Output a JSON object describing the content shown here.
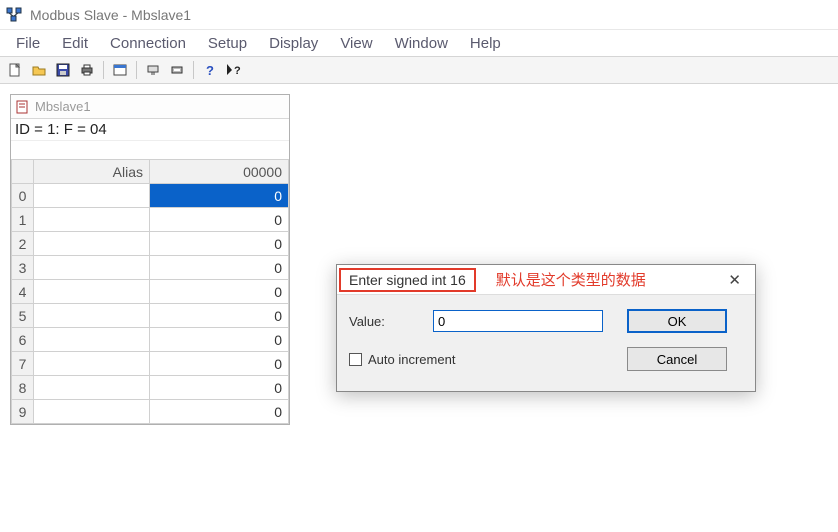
{
  "app": {
    "title": "Modbus Slave - Mbslave1"
  },
  "menu": {
    "items": [
      "File",
      "Edit",
      "Connection",
      "Setup",
      "Display",
      "View",
      "Window",
      "Help"
    ]
  },
  "toolbar": {
    "icons": [
      "new",
      "open",
      "save",
      "print",
      "sep",
      "window",
      "sep",
      "serial",
      "printer2",
      "sep",
      "help",
      "whatsthis"
    ]
  },
  "child": {
    "title": "Mbslave1",
    "status": "ID = 1: F = 04",
    "columns": {
      "alias": "Alias",
      "value": "00000"
    },
    "rows": [
      {
        "index": "0",
        "alias": "",
        "value": "0",
        "selected": true
      },
      {
        "index": "1",
        "alias": "",
        "value": "0"
      },
      {
        "index": "2",
        "alias": "",
        "value": "0"
      },
      {
        "index": "3",
        "alias": "",
        "value": "0"
      },
      {
        "index": "4",
        "alias": "",
        "value": "0"
      },
      {
        "index": "5",
        "alias": "",
        "value": "0"
      },
      {
        "index": "6",
        "alias": "",
        "value": "0"
      },
      {
        "index": "7",
        "alias": "",
        "value": "0"
      },
      {
        "index": "8",
        "alias": "",
        "value": "0"
      },
      {
        "index": "9",
        "alias": "",
        "value": "0"
      }
    ]
  },
  "dialog": {
    "title": "Enter signed int 16",
    "annotation": "默认是这个类型的数据",
    "close": "✕",
    "value_label": "Value:",
    "value": "0",
    "auto_increment_label": "Auto increment",
    "auto_increment_checked": false,
    "ok_label": "OK",
    "cancel_label": "Cancel"
  }
}
